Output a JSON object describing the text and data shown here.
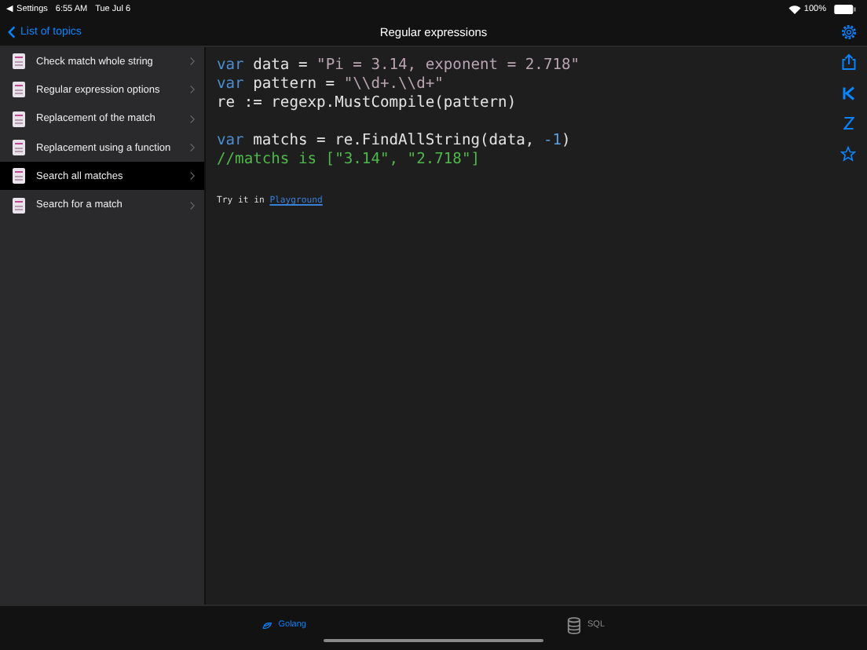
{
  "status_bar": {
    "back_app": "◀ Settings",
    "time": "6:55 AM",
    "date": "Tue Jul 6",
    "battery": "100%"
  },
  "nav": {
    "back": "List of topics",
    "title": "Regular expressions"
  },
  "sidebar": {
    "items": [
      {
        "label": "Check match whole string",
        "selected": false
      },
      {
        "label": "Regular expression options",
        "selected": false
      },
      {
        "label": "Replacement of the match",
        "selected": false
      },
      {
        "label": "Replacement using a function",
        "selected": false
      },
      {
        "label": "Search all matches",
        "selected": true
      },
      {
        "label": "Search for a match",
        "selected": false
      }
    ]
  },
  "code_blocks": [
    {
      "lines": [
        [
          {
            "kind": "keyword",
            "text": "var"
          },
          {
            "kind": "plain",
            "text": " data = "
          },
          {
            "kind": "string",
            "text": "\"Pi = 3.14, exponent = 2.718\""
          }
        ],
        [
          {
            "kind": "keyword",
            "text": "var"
          },
          {
            "kind": "plain",
            "text": " pattern = "
          },
          {
            "kind": "string",
            "text": "\"\\\\d+.\\\\d+\""
          }
        ],
        [
          {
            "kind": "plain",
            "text": "re := regexp.MustCompile(pattern)"
          }
        ]
      ]
    },
    {
      "lines": [
        [
          {
            "kind": "keyword",
            "text": "var"
          },
          {
            "kind": "plain",
            "text": " matchs = re.FindAllString(data, "
          },
          {
            "kind": "number",
            "text": "-1"
          },
          {
            "kind": "plain",
            "text": ")"
          }
        ],
        [
          {
            "kind": "comment",
            "text": "//matchs is [\"3.14\", \"2.718\"]"
          }
        ]
      ]
    }
  ],
  "try_it": {
    "text": "Try it in",
    "link": "Playground"
  },
  "tab_bar": [
    {
      "label": "Golang",
      "selected": true
    },
    {
      "label": "SQL",
      "selected": false
    }
  ]
}
